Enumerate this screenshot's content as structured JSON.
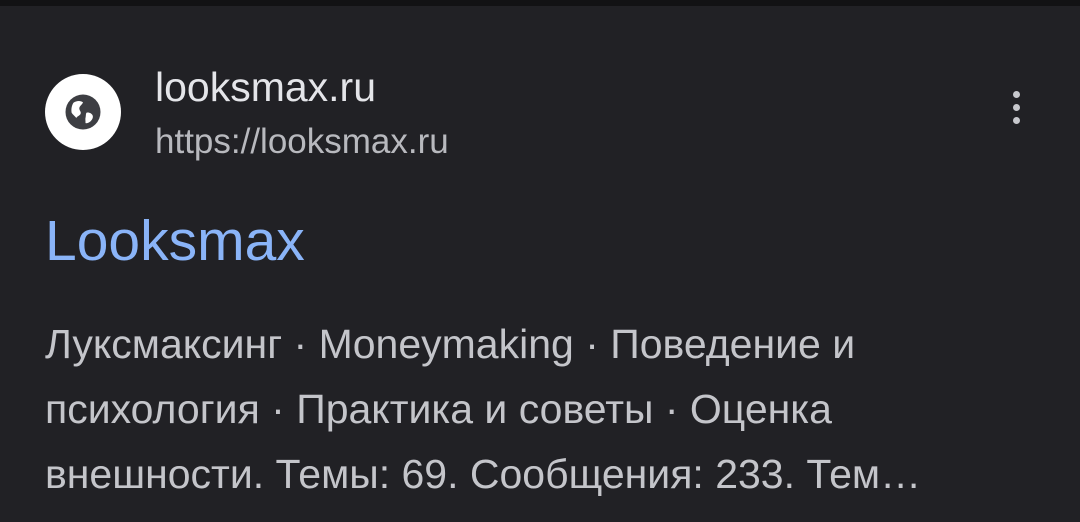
{
  "result": {
    "favicon_icon": "globe-icon",
    "site_name": "looksmax.ru",
    "url": "https://looksmax.ru",
    "menu_icon": "more-vert-icon",
    "title": "Looksmax",
    "snippet_lines": [
      "Луксмаксинг · Moneymaking · Поведение и",
      "психология · Практика и советы · Оценка",
      "внешности. Темы: 69. Сообщения: 233. Тем…"
    ]
  },
  "colors": {
    "background": "#212125",
    "title_link": "#8ab4f8",
    "site_name": "#e4e5e9",
    "url": "#b8b9be",
    "snippet": "#c4c5ca"
  }
}
